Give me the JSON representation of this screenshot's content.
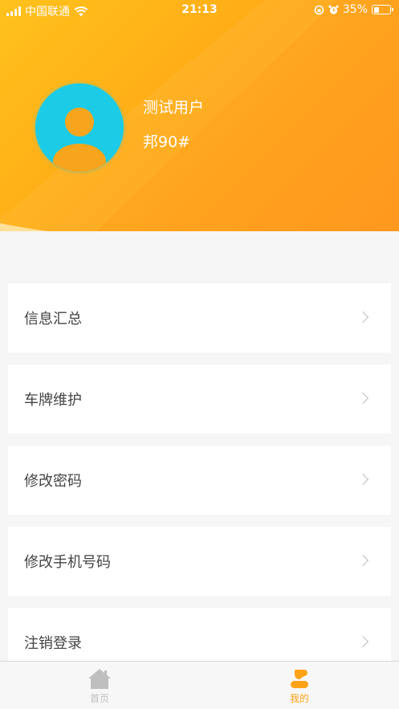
{
  "status_bar": {
    "carrier": "中国联通",
    "time": "21:13",
    "battery": "35%",
    "battery_level": 0.35
  },
  "profile": {
    "name": "测试用户",
    "plate": "邦90#"
  },
  "menu": {
    "items": [
      {
        "label": "信息汇总"
      },
      {
        "label": "车牌维护"
      },
      {
        "label": "修改密码"
      },
      {
        "label": "修改手机号码"
      },
      {
        "label": "注销登录"
      }
    ]
  },
  "tabbar": {
    "home_label": "首页",
    "mine_label": "我的",
    "active_tab": "mine"
  },
  "colors": {
    "accent": "#ffa316",
    "avatar_bg": "#1ccbe6",
    "inactive_tab": "#bfbfbf",
    "active_tab": "#ffa316"
  },
  "icons": [
    "signal-icon",
    "wifi-icon",
    "orientation-lock-icon",
    "alarm-icon",
    "battery-icon",
    "avatar-icon",
    "chevron-right-icon",
    "home-icon",
    "user-icon"
  ]
}
